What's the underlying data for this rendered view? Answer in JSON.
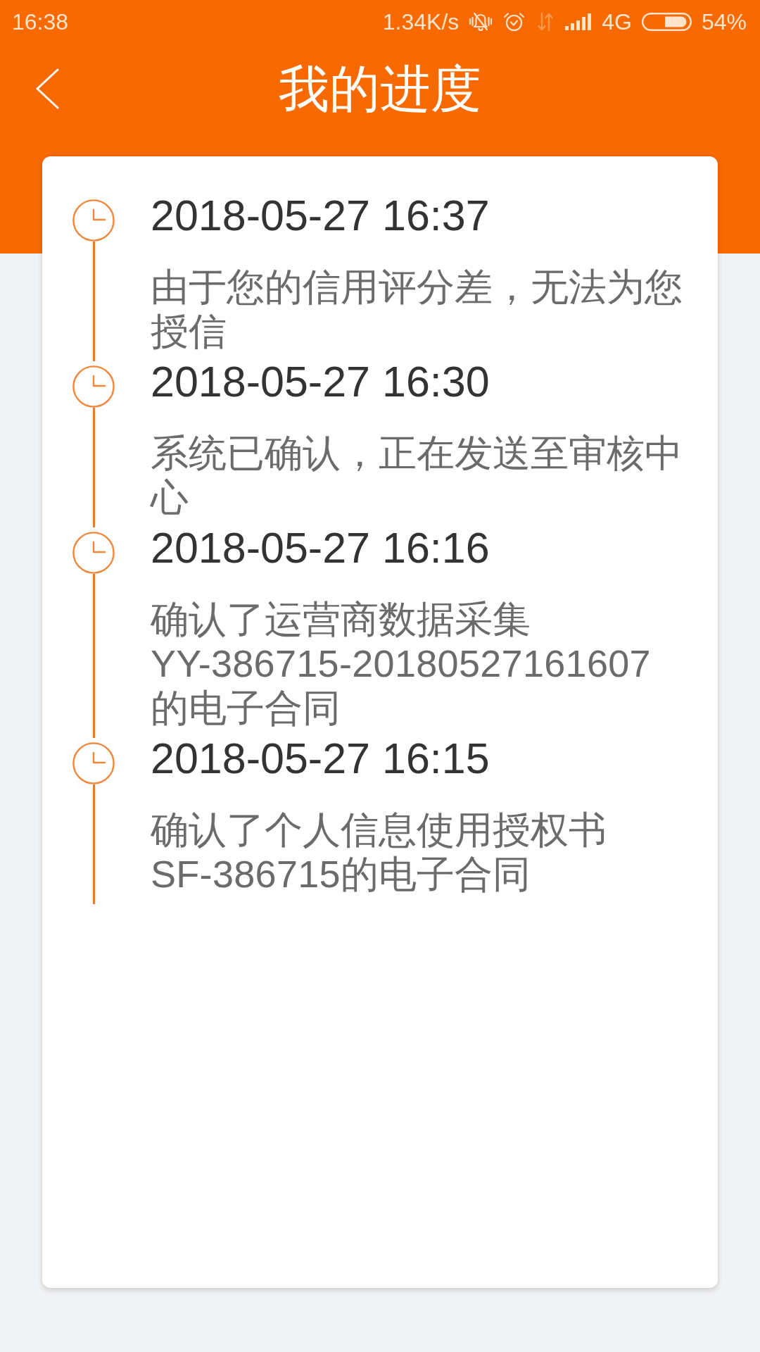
{
  "status_bar": {
    "time": "16:38",
    "network_speed": "1.34K/s",
    "network_type": "4G",
    "battery": "54%"
  },
  "header": {
    "title": "我的进度"
  },
  "timeline": [
    {
      "time": "2018-05-27 16:37",
      "description": "由于您的信用评分差，无法为您授信"
    },
    {
      "time": "2018-05-27 16:30",
      "description": "系统已确认，正在发送至审核中心"
    },
    {
      "time": "2018-05-27 16:16",
      "description": "确认了运营商数据采集YY-386715-20180527161607的电子合同"
    },
    {
      "time": "2018-05-27 16:15",
      "description": "确认了个人信息使用授权书SF-386715的电子合同"
    }
  ]
}
